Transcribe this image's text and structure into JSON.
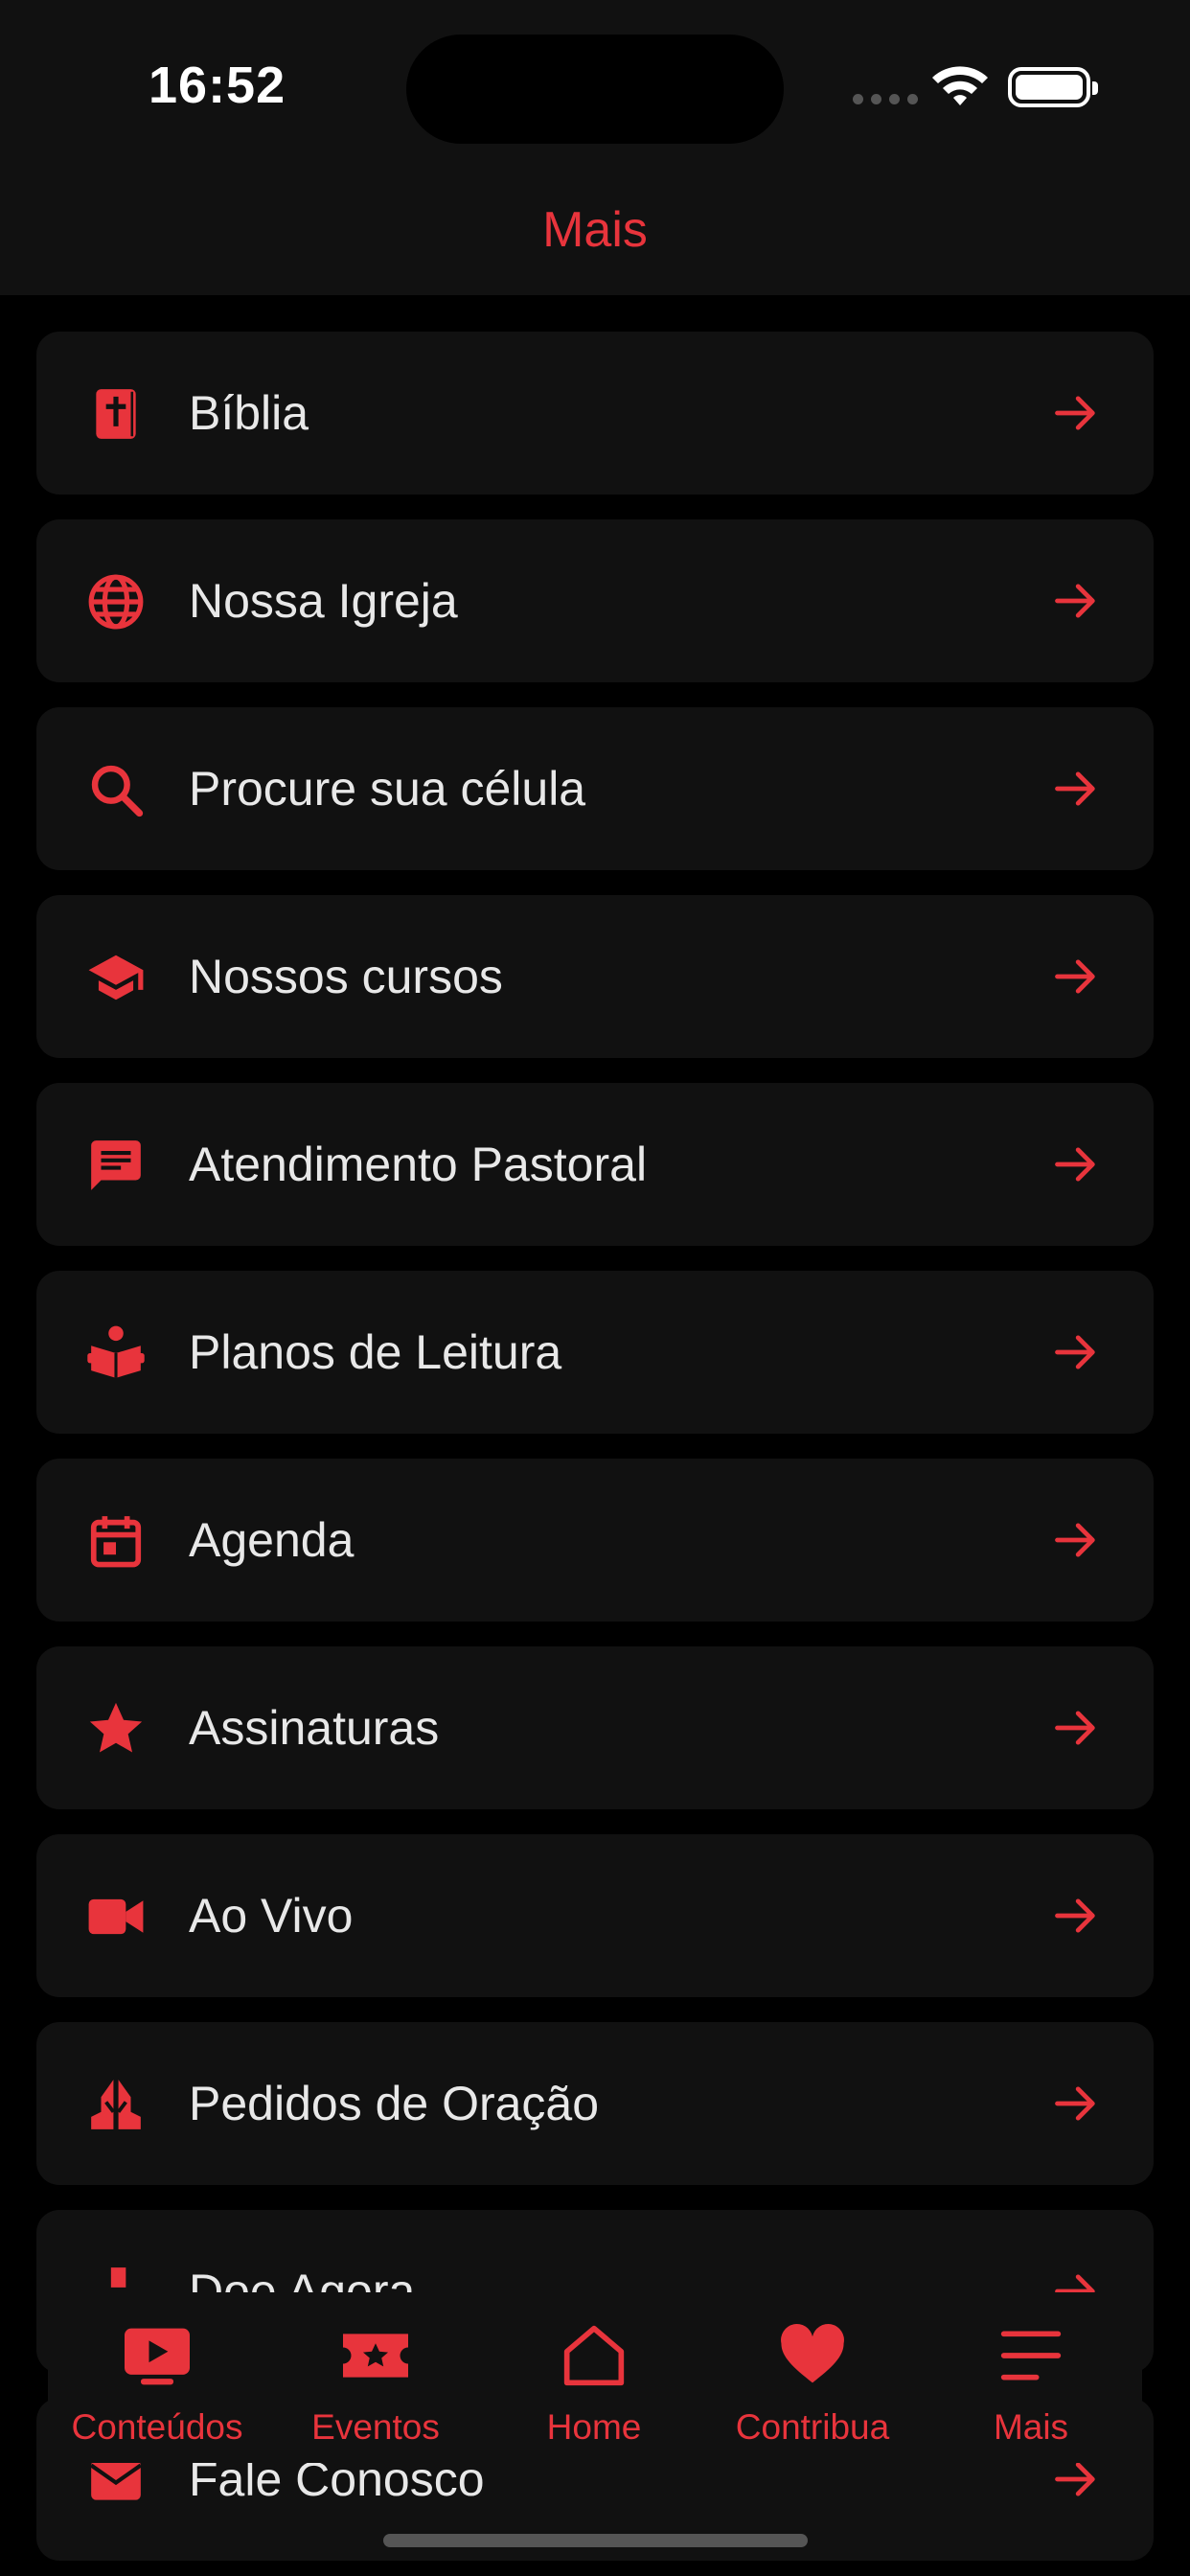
{
  "status_bar": {
    "time": "16:52"
  },
  "header": {
    "title": "Mais"
  },
  "colors": {
    "accent": "#e8343c",
    "card": "#111111",
    "background": "#000000",
    "text": "#e8e8e8"
  },
  "menu": {
    "items": [
      {
        "label": "Bíblia",
        "icon": "bible-icon"
      },
      {
        "label": "Nossa Igreja",
        "icon": "globe-icon"
      },
      {
        "label": "Procure sua célula",
        "icon": "search-icon"
      },
      {
        "label": "Nossos cursos",
        "icon": "graduation-cap-icon"
      },
      {
        "label": "Atendimento Pastoral",
        "icon": "chat-icon"
      },
      {
        "label": "Planos de Leitura",
        "icon": "reading-icon"
      },
      {
        "label": "Agenda",
        "icon": "calendar-icon"
      },
      {
        "label": "Assinaturas",
        "icon": "star-icon"
      },
      {
        "label": "Ao Vivo",
        "icon": "video-camera-icon"
      },
      {
        "label": "Pedidos de Oração",
        "icon": "praying-hands-icon"
      },
      {
        "label": "Doe Agora",
        "icon": "donation-icon"
      },
      {
        "label": "Fale Conosco",
        "icon": "mail-icon"
      }
    ]
  },
  "tabbar": {
    "tabs": [
      {
        "label": "Conteúdos",
        "icon": "play-screen-icon"
      },
      {
        "label": "Eventos",
        "icon": "ticket-icon"
      },
      {
        "label": "Home",
        "icon": "home-icon"
      },
      {
        "label": "Contribua",
        "icon": "heart-icon"
      },
      {
        "label": "Mais",
        "icon": "menu-icon"
      }
    ],
    "selected": "Mais"
  }
}
